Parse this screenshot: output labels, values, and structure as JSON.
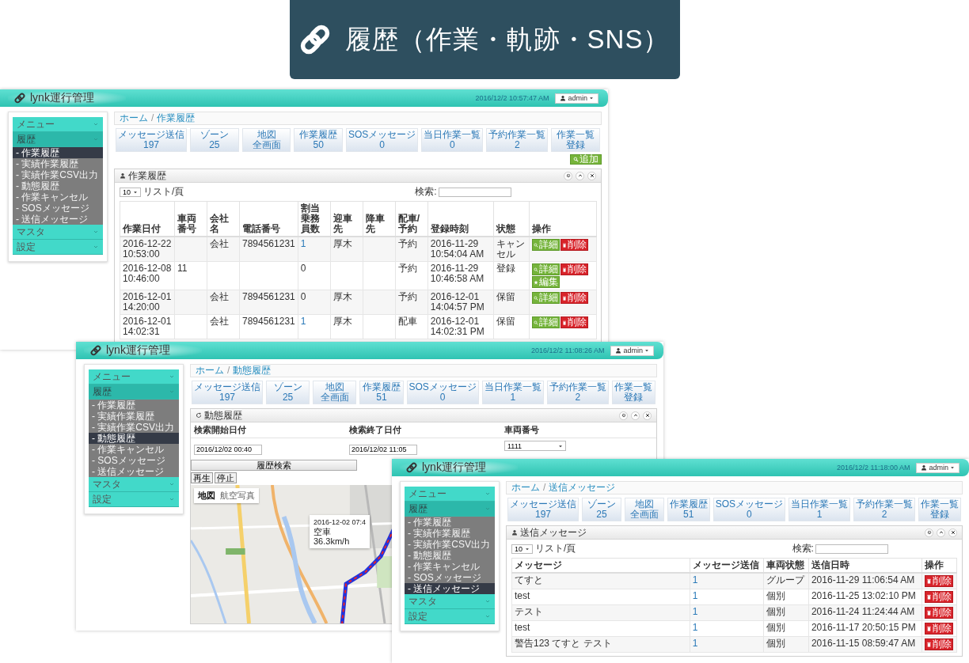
{
  "banner": {
    "title": "履歴（作業・軌跡・SNS）"
  },
  "screens": [
    {
      "kind": "table_page",
      "app_title": "lynk運行管理",
      "clock": "2016/12/2 10:57:47 AM",
      "user": "admin",
      "sidebar": [
        {
          "label": "メニュー",
          "expanded": false
        },
        {
          "label": "履歴",
          "expanded": true,
          "children": [
            {
              "label": "- 作業履歴",
              "selected": true
            },
            {
              "label": "- 実績作業履歴",
              "selected": false
            },
            {
              "label": "- 実績作業CSV出力",
              "selected": false
            },
            {
              "label": "- 動態履歴",
              "selected": false
            },
            {
              "label": "- 作業キャンセル",
              "selected": false
            },
            {
              "label": "- SOSメッセージ",
              "selected": false
            },
            {
              "label": "- 送信メッセージ",
              "selected": false
            }
          ]
        },
        {
          "label": "マスタ",
          "expanded": false
        },
        {
          "label": "設定",
          "expanded": false
        }
      ],
      "breadcrumb": {
        "home": "ホーム",
        "separator": "/",
        "current": "作業履歴"
      },
      "tiles": [
        {
          "label": "メッセージ送信",
          "value": "197"
        },
        {
          "label": "ゾーン",
          "value": "25"
        },
        {
          "label": "地図",
          "value": "全画面"
        },
        {
          "label": "作業履歴",
          "value": "50"
        },
        {
          "label": "SOSメッセージ",
          "value": "0"
        },
        {
          "label": "当日作業一覧",
          "value": "0"
        },
        {
          "label": "予約作業一覧",
          "value": "2"
        },
        {
          "label": "作業一覧",
          "value": "登録"
        }
      ],
      "add_button": "追加",
      "panel": {
        "title": "作業履歴",
        "page_size": "10",
        "page_size_label": "リスト/頁",
        "search_label": "検索:",
        "columns": [
          "作業日付",
          "車両番号",
          "会社名",
          "電話番号",
          "割当乗務員数",
          "迎車先",
          "降車先",
          "配車/予約",
          "登録時刻",
          "状態",
          "操作"
        ],
        "rows": [
          {
            "cells": [
              "2016-12-22 10:53:00",
              null,
              "会社",
              "7894561231",
              {
                "text": "1",
                "link": true
              },
              "厚木",
              null,
              "予約",
              "2016-11-29 10:54:04 AM",
              "キャンセル"
            ],
            "actions": [
              {
                "kind": "detail",
                "label": "詳細"
              },
              {
                "kind": "delete",
                "label": "削除"
              }
            ]
          },
          {
            "cells": [
              "2016-12-08 10:46:00",
              "11",
              null,
              null,
              "0",
              null,
              null,
              "予約",
              "2016-11-29 10:46:58 AM",
              "登録"
            ],
            "actions": [
              {
                "kind": "detail",
                "label": "詳細"
              },
              {
                "kind": "delete",
                "label": "削除"
              },
              {
                "kind": "edit",
                "label": "編集"
              }
            ]
          },
          {
            "cells": [
              "2016-12-01 14:20:00",
              null,
              "会社",
              "7894561231",
              "0",
              "厚木",
              null,
              "予約",
              "2016-12-01 14:04:57 PM",
              "保留"
            ],
            "actions": [
              {
                "kind": "detail",
                "label": "詳細"
              },
              {
                "kind": "delete",
                "label": "削除"
              }
            ]
          },
          {
            "cells": [
              "2016-12-01 14:02:31",
              null,
              "会社",
              "7894561231",
              {
                "text": "1",
                "link": true
              },
              "厚木",
              null,
              "配車",
              "2016-12-01 14:02:31 PM",
              "保留"
            ],
            "actions": [
              {
                "kind": "detail",
                "label": "詳細"
              },
              {
                "kind": "delete",
                "label": "削除"
              }
            ]
          }
        ]
      }
    },
    {
      "kind": "track_page",
      "app_title": "lynk運行管理",
      "clock": "2016/12/2 11:08:26 AM",
      "user": "admin",
      "sidebar": [
        {
          "label": "メニュー",
          "expanded": false
        },
        {
          "label": "履歴",
          "expanded": true,
          "children": [
            {
              "label": "- 作業履歴",
              "selected": false
            },
            {
              "label": "- 実績作業履歴",
              "selected": false
            },
            {
              "label": "- 実績作業CSV出力",
              "selected": false
            },
            {
              "label": "- 動態履歴",
              "selected": true
            },
            {
              "label": "- 作業キャンセル",
              "selected": false
            },
            {
              "label": "- SOSメッセージ",
              "selected": false
            },
            {
              "label": "- 送信メッセージ",
              "selected": false
            }
          ]
        },
        {
          "label": "マスタ",
          "expanded": false
        },
        {
          "label": "設定",
          "expanded": false
        }
      ],
      "breadcrumb": {
        "home": "ホーム",
        "separator": "/",
        "current": "動態履歴"
      },
      "tiles": [
        {
          "label": "メッセージ送信",
          "value": "197"
        },
        {
          "label": "ゾーン",
          "value": "25"
        },
        {
          "label": "地図",
          "value": "全画面"
        },
        {
          "label": "作業履歴",
          "value": "51"
        },
        {
          "label": "SOSメッセージ",
          "value": "0"
        },
        {
          "label": "当日作業一覧",
          "value": "1"
        },
        {
          "label": "予約作業一覧",
          "value": "2"
        },
        {
          "label": "作業一覧",
          "value": "登録"
        }
      ],
      "panel": {
        "title": "動態履歴",
        "fields": [
          {
            "kind": "text",
            "label": "検索開始日付",
            "value": "2016/12/02 00:40"
          },
          {
            "kind": "text",
            "label": "検索終了日付",
            "value": "2016/12/02 11:05"
          },
          {
            "kind": "select",
            "label": "車両番号",
            "value": "1111"
          }
        ],
        "search_button": "履歴検索",
        "playback_buttons": [
          "再生",
          "停止"
        ],
        "map": {
          "kind": "picture",
          "types": [
            {
              "label": "地図",
              "selected": true
            },
            {
              "label": "航空写真",
              "selected": false
            }
          ],
          "popup": [
            "2016-12-02 07:4",
            "空車",
            "36.3km/h"
          ]
        }
      }
    },
    {
      "kind": "table_page",
      "app_title": "lynk運行管理",
      "clock": "2016/12/2 11:18:00 AM",
      "user": "admin",
      "sidebar": [
        {
          "label": "メニュー",
          "expanded": false
        },
        {
          "label": "履歴",
          "expanded": true,
          "children": [
            {
              "label": "- 作業履歴",
              "selected": false
            },
            {
              "label": "- 実績作業履歴",
              "selected": false
            },
            {
              "label": "- 実績作業CSV出力",
              "selected": false
            },
            {
              "label": "- 動態履歴",
              "selected": false
            },
            {
              "label": "- 作業キャンセル",
              "selected": false
            },
            {
              "label": "- SOSメッセージ",
              "selected": false
            },
            {
              "label": "- 送信メッセージ",
              "selected": true
            }
          ]
        },
        {
          "label": "マスタ",
          "expanded": false
        },
        {
          "label": "設定",
          "expanded": false
        }
      ],
      "breadcrumb": {
        "home": "ホーム",
        "separator": "/",
        "current": "送信メッセージ"
      },
      "tiles": [
        {
          "label": "メッセージ送信",
          "value": "197"
        },
        {
          "label": "ゾーン",
          "value": "25"
        },
        {
          "label": "地図",
          "value": "全画面"
        },
        {
          "label": "作業履歴",
          "value": "51"
        },
        {
          "label": "SOSメッセージ",
          "value": "0"
        },
        {
          "label": "当日作業一覧",
          "value": "1"
        },
        {
          "label": "予約作業一覧",
          "value": "2"
        },
        {
          "label": "作業一覧",
          "value": "登録"
        }
      ],
      "panel": {
        "title": "送信メッセージ",
        "page_size": "10",
        "page_size_label": "リスト/頁",
        "search_label": "検索:",
        "columns": [
          "メッセージ",
          "メッセージ送信",
          "車両状態",
          "送信日時",
          "操作"
        ],
        "rows": [
          {
            "cells": [
              "てすと",
              {
                "text": "1",
                "link": true
              },
              "グループ",
              "2016-11-29 11:06:54 AM"
            ],
            "actions": [
              {
                "kind": "delete",
                "label": "削除"
              }
            ]
          },
          {
            "cells": [
              "test",
              {
                "text": "1",
                "link": true
              },
              "個別",
              "2016-11-25 13:02:10 PM"
            ],
            "actions": [
              {
                "kind": "delete",
                "label": "削除"
              }
            ]
          },
          {
            "cells": [
              "テスト",
              {
                "text": "1",
                "link": true
              },
              "個別",
              "2016-11-24 11:24:44 AM"
            ],
            "actions": [
              {
                "kind": "delete",
                "label": "削除"
              }
            ]
          },
          {
            "cells": [
              "test",
              {
                "text": "1",
                "link": true
              },
              "個別",
              "2016-11-17 20:50:15 PM"
            ],
            "actions": [
              {
                "kind": "delete",
                "label": "削除"
              }
            ]
          },
          {
            "cells": [
              "警告123 てすと テスト",
              {
                "text": "1",
                "link": true
              },
              "個別",
              "2016-11-15 08:59:47 AM"
            ],
            "actions": [
              {
                "kind": "delete",
                "label": "削除"
              }
            ]
          }
        ]
      }
    }
  ]
}
